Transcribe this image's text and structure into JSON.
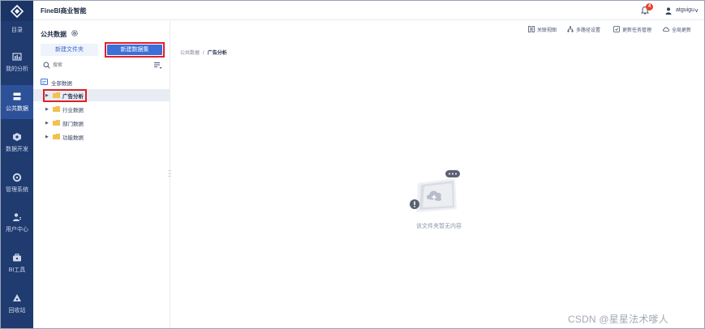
{
  "app": {
    "title": "FineBI商业智能"
  },
  "rail": {
    "items": [
      {
        "label": "目录",
        "icon": "catalog-icon"
      },
      {
        "label": "我的分析",
        "icon": "analysis-icon"
      },
      {
        "label": "公共数据",
        "icon": "public-data-icon"
      },
      {
        "label": "数据开发",
        "icon": "data-dev-icon"
      },
      {
        "label": "管理系统",
        "icon": "admin-icon"
      },
      {
        "label": "用户中心",
        "icon": "user-center-icon"
      },
      {
        "label": "BI工具",
        "icon": "bi-tools-icon"
      },
      {
        "label": "回收站",
        "icon": "recycle-icon"
      }
    ]
  },
  "header": {
    "notification_count": "4",
    "username": "atguigu",
    "caret": "∨"
  },
  "panel": {
    "title": "公共数据",
    "new_folder_label": "新建文件夹",
    "new_dataset_label": "新建数据集",
    "search_placeholder": "搜索",
    "tree_root": "全部数据",
    "folders": [
      {
        "label": "广告分析",
        "selected": true
      },
      {
        "label": "行业数据",
        "selected": false
      },
      {
        "label": "部门数据",
        "selected": false
      },
      {
        "label": "功能数据",
        "selected": false
      }
    ]
  },
  "toolbar": {
    "items": [
      {
        "label": "关联视图",
        "icon": "relation-view-icon"
      },
      {
        "label": "多路径设置",
        "icon": "multi-path-icon"
      },
      {
        "label": "更新任务管理",
        "icon": "update-task-icon"
      },
      {
        "label": "全局更新",
        "icon": "global-update-icon"
      }
    ]
  },
  "breadcrumb": {
    "root": "公共数据",
    "separator": "/",
    "current": "广告分析"
  },
  "empty_state": {
    "text": "该文件夹暂无内容"
  },
  "watermark": "CSDN @星星法术嗲人",
  "colors": {
    "rail_bg": "#1f3b70",
    "rail_active": "#2d5199",
    "primary": "#3d6fd8",
    "highlight": "#e0202a",
    "badge": "#e8412c"
  }
}
